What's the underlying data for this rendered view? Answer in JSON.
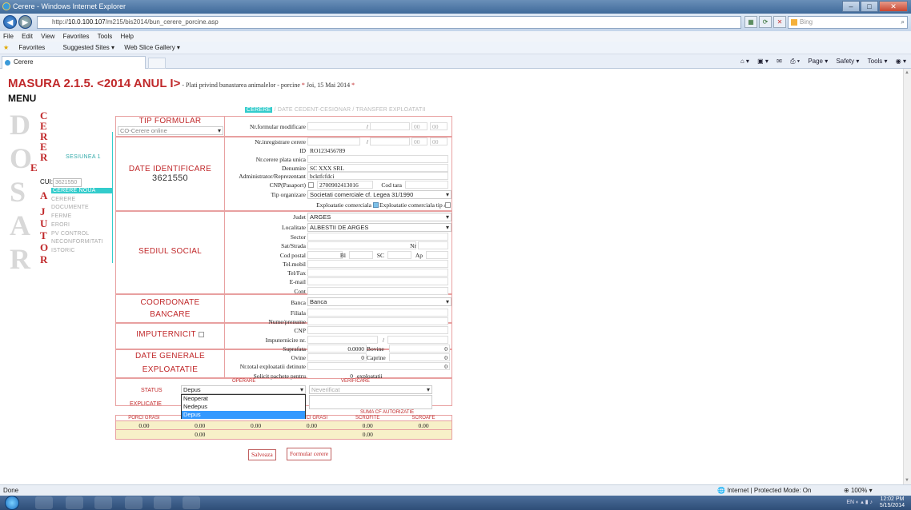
{
  "browser": {
    "window_title": "Cerere - Windows Internet Explorer",
    "url_prefix": "http://",
    "url_host": "10.0.100.107",
    "url_path": "/m215/bis2014/bun_cerere_porcine.asp",
    "search_placeholder": "Bing",
    "menu": [
      "File",
      "Edit",
      "View",
      "Favorites",
      "Tools",
      "Help"
    ],
    "favorites_label": "Favorites",
    "fav_links": [
      "Suggested Sites ▾",
      "Web Slice Gallery ▾"
    ],
    "tab_title": "Cerere",
    "commands": [
      "Page ▾",
      "Safety ▾",
      "Tools ▾"
    ]
  },
  "header": {
    "title": "MASURA 2.1.5. <2014 ANUL I>",
    "subtitle": " - Plati privind bunastarea animalelor - porcine",
    "star": " * ",
    "date": "Joi, 15 Mai 2014",
    "star_end": " *",
    "menu_label": "MENU"
  },
  "sidebar": {
    "watermark": [
      "D",
      "O",
      "S",
      "A",
      "R"
    ],
    "letters": [
      "C",
      "E",
      "R",
      "E",
      "R",
      "E",
      "A",
      "J",
      "U",
      "T",
      "O",
      "R"
    ],
    "session": "SESIUNEA 1",
    "cui_label": "CUI:",
    "cui_value": "3621550",
    "items": [
      {
        "label": "CERERE NOUA",
        "active": true
      },
      {
        "label": "CERERE",
        "active": false
      },
      {
        "label": "DOCUMENTE",
        "active": false
      },
      {
        "label": "FERME",
        "active": false
      },
      {
        "label": "ERORI",
        "active": false
      },
      {
        "label": "PV CONTROL",
        "active": false
      },
      {
        "label": "NECONFORMITATI",
        "active": false
      },
      {
        "label": "ISTORIC",
        "active": false
      }
    ]
  },
  "form_tabs": {
    "active": "CERERE",
    "sep1": " / ",
    "t2": "DATE CEDENT-CESIONAR",
    "sep2": " / ",
    "t3": "TRANSFER EXPLOATATII"
  },
  "tip_formular": {
    "heading": "TIP FORMULAR",
    "select_value": "CO-Cerere online",
    "nr_formular_label": "Nr.formular modificare",
    "nr_inregistrare_label": "Nr.inregistrare cerere",
    "slash": "/",
    "time1": "00",
    "time2": "00"
  },
  "identificare": {
    "heading": "DATE IDENTIFICARE",
    "cui": "3621550",
    "id_label": "ID",
    "id_value": "RO123456789",
    "plata_unica_label": "Nr.cerere plata unica",
    "denumire_label": "Denumire",
    "denumire_value": "SC XXX SRL",
    "admin_label": "Administrator/Reprezentant",
    "admin_value": "bcktfcfdci",
    "cnp_label": "CNP(Pasaport)",
    "cnp_value": "2700902413016",
    "cod_tara_label": "Cod tara",
    "tip_org_label": "Tip organizare",
    "tip_org_value": "Societati comerciale cf. Legea 31/1990",
    "expl_comerciala_label": "Exploatatie comerciala",
    "expl_tip_a_label": "Exploatatie comerciala tip A"
  },
  "sediu": {
    "heading": "SEDIUL SOCIAL",
    "judet_label": "Judet",
    "judet_value": "ARGES",
    "localitate_label": "Localitate",
    "localitate_value": "ALBESTII DE ARGES",
    "sector_label": "Sector",
    "sat_label": "Sat/Strada",
    "nr_label": "Nr",
    "cod_postal_label": "Cod postal",
    "bl_label": "Bl",
    "sc_label": "SC",
    "ap_label": "Ap",
    "tel_mobil_label": "Tel.mobil",
    "tel_fax_label": "Tel/Fax",
    "email_label": "E-mail"
  },
  "bancare": {
    "heading1": "COORDONATE",
    "heading2": "BANCARE",
    "cont_label": "Cont",
    "banca_label": "Banca",
    "banca_value": "Banca",
    "filiala_label": "Filiala"
  },
  "imputernicit": {
    "heading": "IMPUTERNICIT",
    "nume_label": "Nume/prenume",
    "cnp_label": "CNP",
    "nr_label": "Imputernicire nr.",
    "slash": "/"
  },
  "generale": {
    "heading1": "DATE GENERALE",
    "heading2": "EXPLOATATIE",
    "suprafata_label": "Suprafata",
    "suprafata_value": "0.0000",
    "bovine_label": "Bovine",
    "bovine_value": "0",
    "ovine_label": "Ovine",
    "ovine_value": "0",
    "caprine_label": "Caprine",
    "caprine_value": "0",
    "total_label": "Nr.total exploatatii detinute",
    "total_value": "0",
    "solicit_label": "Solicit pachete pentru",
    "solicit_value": "0",
    "exploatatii_label": "exploatatii"
  },
  "status": {
    "operare_header": "OPERARE",
    "verificare_header": "VERIFICARE",
    "status_label": "STATUS",
    "status_value": "Depus",
    "verificat_value": "Neverificat",
    "explicatie_label": "EXPLICATIE",
    "dropdown_options": [
      "Neoperat",
      "Nedepus",
      "Depus"
    ],
    "suma_autorizata_header": "SUMA CF AUTORIZATIE",
    "st_header": "ST"
  },
  "totals": {
    "cols": [
      "PORCI GRASI",
      "SCROFITE",
      "SCROAFE",
      "PORCI GRASI",
      "SCROFITE",
      "SCROAFE"
    ],
    "row1": [
      "0.00",
      "0.00",
      "0.00",
      "0.00",
      "0.00",
      "0.00"
    ],
    "row2": [
      "0.00",
      "0.00"
    ]
  },
  "buttons": {
    "save": "Salveaza",
    "form": "Formular cerere"
  },
  "statusbar": {
    "left": "Done",
    "zone": "Internet | Protected Mode: On",
    "zoom": "100%"
  },
  "taskbar": {
    "time": "12:02 PM",
    "date": "5/15/2014",
    "lang": "EN"
  },
  "colors": {
    "accent_red": "#c0282a",
    "accent_teal": "#33cccc",
    "table_fill": "#f7f0c8"
  }
}
